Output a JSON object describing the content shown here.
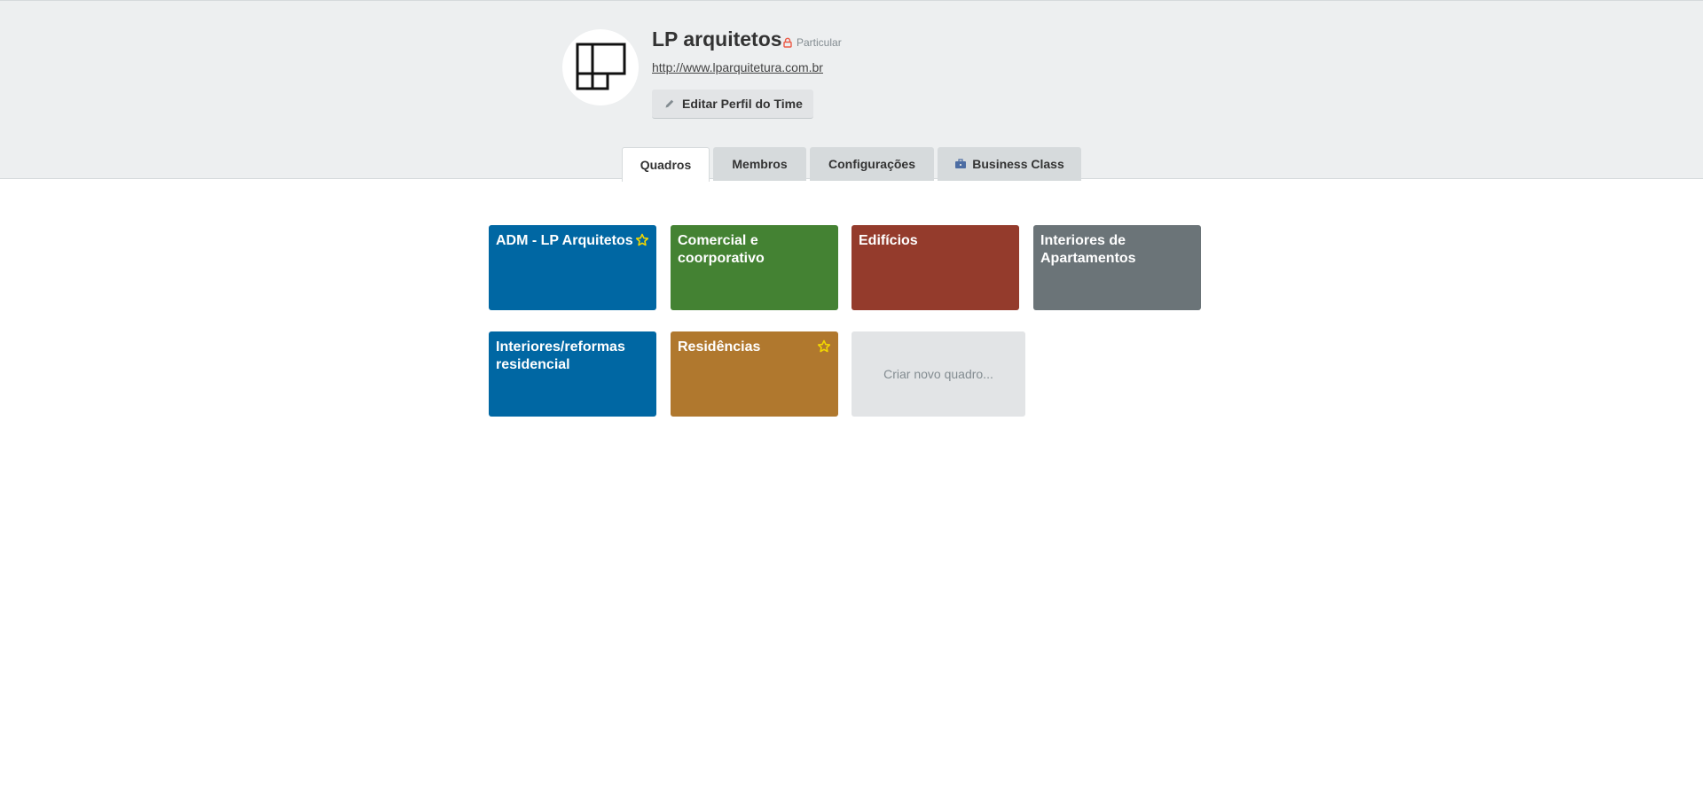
{
  "team": {
    "name": "LP arquitetos",
    "privacy": "Particular",
    "website": "http://www.lparquitetura.com.br",
    "edit_button": "Editar Perfil do Time"
  },
  "tabs": [
    {
      "label": "Quadros",
      "active": true
    },
    {
      "label": "Membros",
      "active": false
    },
    {
      "label": "Configurações",
      "active": false
    },
    {
      "label": "Business Class",
      "active": false,
      "icon": "briefcase-icon"
    }
  ],
  "boards": [
    {
      "title": "ADM - LP Arquitetos",
      "color": "#0067a3",
      "starred": true
    },
    {
      "title": "Comercial e coorporativo",
      "color": "#448233",
      "starred": false
    },
    {
      "title": "Edifícios",
      "color": "#943b2c",
      "starred": false
    },
    {
      "title": "Interiores de Apartamentos",
      "color": "#6b7478",
      "starred": false
    },
    {
      "title": "Interiores/reformas residencial",
      "color": "#0067a3",
      "starred": false
    },
    {
      "title": "Residências",
      "color": "#b0782e",
      "starred": true
    }
  ],
  "create_board": "Criar novo quadro...",
  "colors": {
    "header_bg": "#edeff0",
    "tab_bg": "#d6dadc",
    "privacy_icon": "#eb5a46",
    "star": "#f2d600"
  }
}
